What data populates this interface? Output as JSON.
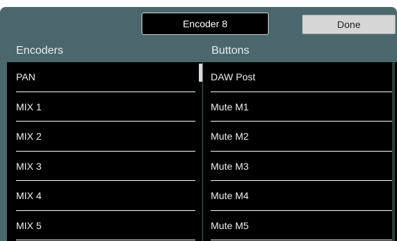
{
  "header": {
    "encoder_title": "Encoder 8",
    "done_label": "Done"
  },
  "columns": {
    "encoders_header": "Encoders",
    "buttons_header": "Buttons"
  },
  "encoders": [
    {
      "label": "PAN"
    },
    {
      "label": "MIX 1"
    },
    {
      "label": "MIX 2"
    },
    {
      "label": "MIX 3"
    },
    {
      "label": "MIX 4"
    },
    {
      "label": "MIX 5"
    }
  ],
  "buttons": [
    {
      "label": "DAW Post"
    },
    {
      "label": "Mute M1"
    },
    {
      "label": "Mute M2"
    },
    {
      "label": "Mute M3"
    },
    {
      "label": "Mute M4"
    },
    {
      "label": "Mute M5"
    }
  ],
  "colors": {
    "panel": "#4b676c",
    "list_bg": "#000000",
    "done_bg": "#d6d6d6"
  }
}
